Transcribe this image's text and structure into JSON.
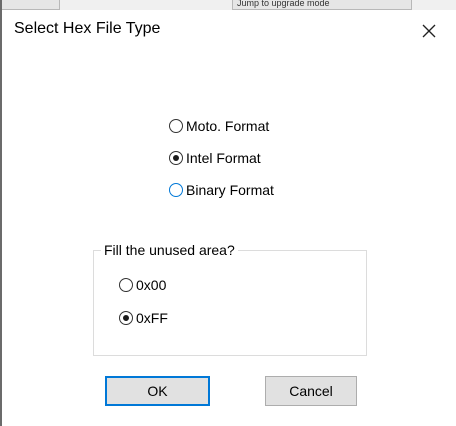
{
  "background": {
    "tab_text": "Jump to upgrade mode"
  },
  "dialog": {
    "title": "Select Hex File Type",
    "close_icon": "close-icon"
  },
  "format": {
    "options": [
      {
        "label": "Moto. Format",
        "checked": false
      },
      {
        "label": "Intel Format",
        "checked": true
      },
      {
        "label": "Binary Format",
        "checked": false
      }
    ]
  },
  "fill": {
    "group_label": "Fill the unused area?",
    "options": [
      {
        "label": "0x00",
        "checked": false
      },
      {
        "label": "0xFF",
        "checked": true
      }
    ]
  },
  "buttons": {
    "ok": "OK",
    "cancel": "Cancel"
  },
  "colors": {
    "accent": "#0078d7",
    "button_face": "#e1e1e1"
  }
}
